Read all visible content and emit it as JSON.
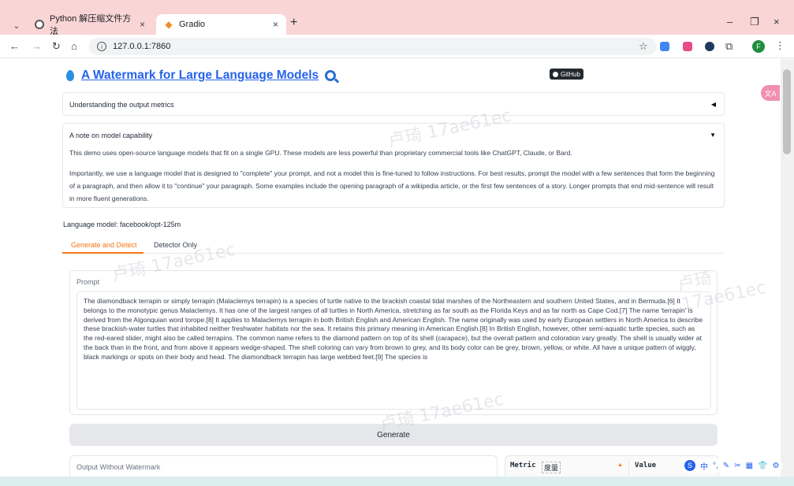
{
  "browser": {
    "tabs": [
      {
        "title": "Python 解压缩文件方法",
        "close": "×"
      },
      {
        "title": "Gradio",
        "close": "×"
      }
    ],
    "new_tab": "+",
    "window_controls": {
      "minimize": "–",
      "restore": "❐",
      "close": "×"
    },
    "url": "127.0.0.1:7860",
    "profile_initial": "F",
    "colors": {
      "titlebar": "#f9d5d5",
      "ext_blue": "#4285f4",
      "ext_pink": "#e84b8a",
      "ext_dark": "#1f3a5f",
      "profile": "#1e8e3e"
    }
  },
  "header": {
    "title": "A Watermark for Large Language Models",
    "github_label": "GitHub"
  },
  "accordions": [
    {
      "label": "Understanding the output metrics",
      "arrow": "◀"
    },
    {
      "label": "A note on model capability",
      "arrow": "▼",
      "paragraph1": "This demo uses open-source language models that fit on a single GPU. These models are less powerful than proprietary commercial tools like ChatGPT, Claude, or Bard.",
      "paragraph2": "Importantly, we use a language model that is designed to \"complete\" your prompt, and not a model this is fine-tuned to follow instructions. For best results, prompt the model with a few sentences that form the beginning of a paragraph, and then allow it to \"continue\" your paragraph. Some examples include the opening paragraph of a wikipedia article, or the first few sentences of a story. Longer prompts that end mid-sentence will result in more fluent generations."
    }
  ],
  "model_line": "Language model: facebook/opt-125m",
  "tabs": [
    {
      "label": "Generate and Detect",
      "active": true
    },
    {
      "label": "Detector Only",
      "active": false
    }
  ],
  "prompt": {
    "label": "Prompt",
    "value": "The diamondback terrapin or simply terrapin (Malaclemys terrapin) is a species of turtle native to the brackish coastal tidal marshes of the Northeastern and southern United States, and in Bermuda.[6] It belongs to the monotypic genus Malaclemys. It has one of the largest ranges of all turtles in North America, stretching as far south as the Florida Keys and as far north as Cape Cod.[7] The name 'terrapin' is derived from the Algonquian word torope.[8] It applies to Malaclemys terrapin in both British English and American English. The name originally was used by early European settlers in North America to describe these brackish-water turtles that inhabited neither freshwater habitats nor the sea. It retains this primary meaning in American English.[8] In British English, however, other semi-aquatic turtle species, such as the red-eared slider, might also be called terrapins. The common name refers to the diamond pattern on top of its shell (carapace), but the overall pattern and coloration vary greatly. The shell is usually wider at the back than in the front, and from above it appears wedge-shaped. The shell coloring can vary from brown to grey, and its body color can be grey, brown, yellow, or white. All have a unique pattern of wiggly, black markings or spots on their body and head. The diamondback terrapin has large webbed feet.[9] The species is"
  },
  "generate_label": "Generate",
  "output": {
    "without_watermark_label": "Output Without Watermark",
    "metric_header": "Metric",
    "metric_extra": "度量",
    "sort_indicator": "▲",
    "value_header": "Value"
  },
  "watermark_text": "卢琦 17ae61ec",
  "ime": {
    "items": [
      "中",
      "°,",
      "✎",
      "✂",
      "▦",
      "👕",
      "⚙"
    ]
  },
  "side_badge": "文A",
  "accent_color": "#f97316",
  "link_color": "#2563eb"
}
